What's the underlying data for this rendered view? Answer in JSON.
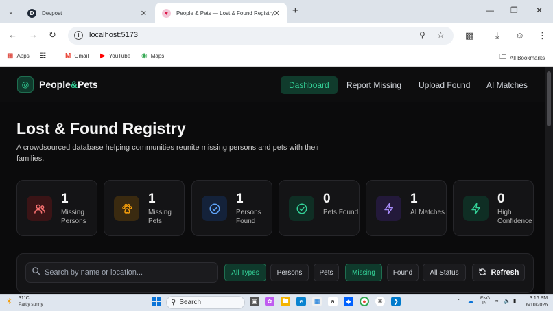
{
  "browser": {
    "tabs": [
      {
        "title": "Devpost",
        "favicon": "D"
      },
      {
        "title": "People & Pets — Lost & Found Registry"
      }
    ],
    "url": "localhost:5173",
    "bookmarks": [
      "Apps",
      "Gmail",
      "YouTube",
      "Maps"
    ],
    "all_bookmarks": "All Bookmarks"
  },
  "app": {
    "brand_left": "People",
    "brand_amp": "&",
    "brand_right": "Pets",
    "nav": [
      "Dashboard",
      "Report Missing",
      "Upload Found",
      "AI Matches"
    ],
    "hero_title": "Lost & Found Registry",
    "hero_subtitle": "A crowdsourced database helping communities reunite missing persons and pets with their families.",
    "stats": [
      {
        "value": "1",
        "label": "Missing Persons",
        "icon": "people-icon",
        "color": "#f87171"
      },
      {
        "value": "1",
        "label": "Missing Pets",
        "icon": "paw-icon",
        "color": "#f59e0b"
      },
      {
        "value": "1",
        "label": "Persons Found",
        "icon": "check-circle-icon",
        "color": "#60a5fa"
      },
      {
        "value": "0",
        "label": "Pets Found",
        "icon": "check-circle-icon",
        "color": "#34d399"
      },
      {
        "value": "1",
        "label": "AI Matches",
        "icon": "lightning-icon",
        "color": "#a78bfa"
      },
      {
        "value": "0",
        "label": "High Confidence",
        "icon": "lightning-icon",
        "color": "#34d399"
      }
    ],
    "search_placeholder": "Search by name or location...",
    "filters": [
      "All Types",
      "Persons",
      "Pets",
      "Missing",
      "Found",
      "All Status"
    ],
    "refresh": "Refresh"
  },
  "taskbar": {
    "temp": "31°C",
    "weather": "Partly sunny",
    "search": "Search",
    "lang_top": "ENG",
    "lang_bottom": "IN",
    "time": "3:16 PM",
    "date": "6/10/2026"
  }
}
